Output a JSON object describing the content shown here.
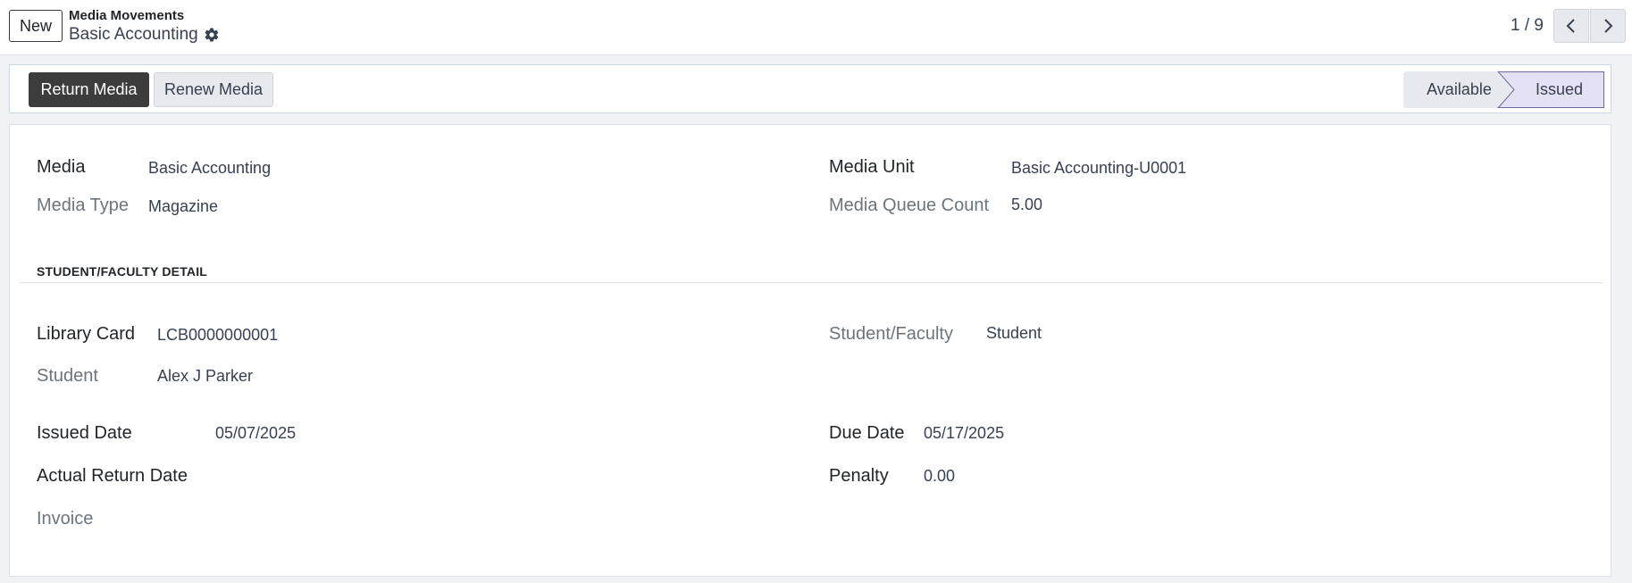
{
  "toolbar": {
    "new_label": "New",
    "breadcrumb_parent": "Media Movements",
    "breadcrumb_current": "Basic Accounting",
    "pager_value": "1 / 9"
  },
  "statusbar": {
    "return_label": "Return Media",
    "renew_label": "Renew Media",
    "stages": [
      "Available",
      "Issued"
    ],
    "active_stage": "Issued"
  },
  "form": {
    "media_label": "Media",
    "media_value": "Basic Accounting",
    "media_type_label": "Media Type",
    "media_type_value": "Magazine",
    "media_unit_label": "Media Unit",
    "media_unit_value": "Basic Accounting-U0001",
    "queue_count_label": "Media Queue Count",
    "queue_count_value": "5.00",
    "section_title": "STUDENT/FACULTY DETAIL",
    "library_card_label": "Library Card",
    "library_card_value": "LCB0000000001",
    "student_faculty_label": "Student/Faculty",
    "student_faculty_value": "Student",
    "student_label": "Student",
    "student_value": "Alex J Parker",
    "issued_date_label": "Issued Date",
    "issued_date_value": "05/07/2025",
    "due_date_label": "Due Date",
    "due_date_value": "05/17/2025",
    "actual_return_label": "Actual Return Date",
    "actual_return_value": "",
    "penalty_label": "Penalty",
    "penalty_value": "0.00",
    "invoice_label": "Invoice",
    "invoice_value": ""
  },
  "icons": {
    "settings": "gear-icon",
    "pager_prev": "chevron-left-icon",
    "pager_next": "chevron-right-icon"
  },
  "colors": {
    "primary_button": "#3c3c3c",
    "active_stage": "#e3e1f3",
    "active_stage_border": "#6f6a9e",
    "background": "#f0f2f5"
  }
}
